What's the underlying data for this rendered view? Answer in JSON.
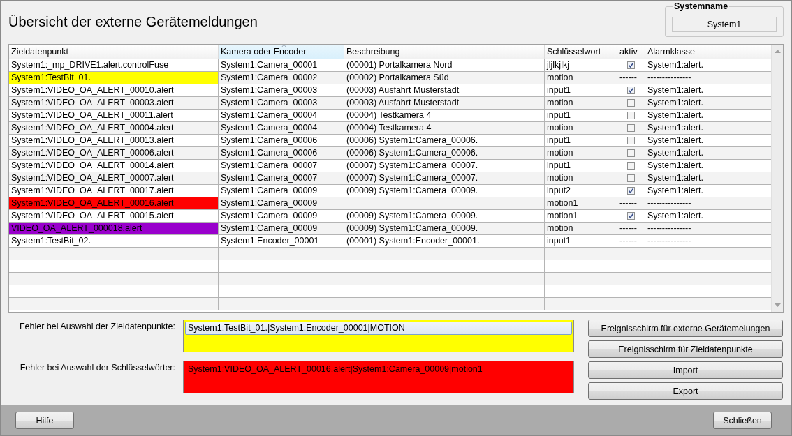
{
  "window": {
    "title": "Übersicht der externe Gerätemeldungen"
  },
  "system_name": {
    "label": "Systemname",
    "value": "System1"
  },
  "table": {
    "columns": [
      {
        "label": "Zieldatenpunkt",
        "sorted": false
      },
      {
        "label": "Kamera oder Encoder",
        "sorted": true
      },
      {
        "label": "Beschreibung",
        "sorted": false
      },
      {
        "label": "Schlüsselwort",
        "sorted": false
      },
      {
        "label": "aktiv",
        "sorted": false
      },
      {
        "label": "Alarmklasse",
        "sorted": false
      }
    ],
    "rows": [
      {
        "target": "System1:_mp_DRIVE1.alert.controlFuse",
        "source": "System1:Camera_00001",
        "description": "(00001) Portalkamera Nord",
        "keyword": "jljlkjlkj",
        "active": {
          "kind": "checkbox",
          "checked": true
        },
        "alarm_class": "System1:alert."
      },
      {
        "target": "System1:TestBit_01.",
        "color": "#ffff00",
        "source": "System1:Camera_00002",
        "description": "(00002) Portalkamera Süd",
        "keyword": "motion",
        "active": {
          "kind": "text",
          "text": "------"
        },
        "alarm_class": "---------------"
      },
      {
        "target": "System1:VIDEO_OA_ALERT_00010.alert",
        "source": "System1:Camera_00003",
        "description": "(00003) Ausfahrt Musterstadt",
        "keyword": "input1",
        "active": {
          "kind": "checkbox",
          "checked": true
        },
        "alarm_class": "System1:alert."
      },
      {
        "target": "System1:VIDEO_OA_ALERT_00003.alert",
        "source": "System1:Camera_00003",
        "description": "(00003) Ausfahrt Musterstadt",
        "keyword": "motion",
        "active": {
          "kind": "checkbox",
          "checked": false
        },
        "alarm_class": "System1:alert."
      },
      {
        "target": "System1:VIDEO_OA_ALERT_00011.alert",
        "source": "System1:Camera_00004",
        "description": "(00004) Testkamera 4",
        "keyword": "input1",
        "active": {
          "kind": "checkbox",
          "checked": false
        },
        "alarm_class": "System1:alert."
      },
      {
        "target": "System1:VIDEO_OA_ALERT_00004.alert",
        "source": "System1:Camera_00004",
        "description": "(00004) Testkamera 4",
        "keyword": "motion",
        "active": {
          "kind": "checkbox",
          "checked": false
        },
        "alarm_class": "System1:alert."
      },
      {
        "target": "System1:VIDEO_OA_ALERT_00013.alert",
        "source": "System1:Camera_00006",
        "description": "(00006) System1:Camera_00006.",
        "keyword": "input1",
        "active": {
          "kind": "checkbox",
          "checked": false
        },
        "alarm_class": "System1:alert."
      },
      {
        "target": "System1:VIDEO_OA_ALERT_00006.alert",
        "source": "System1:Camera_00006",
        "description": "(00006) System1:Camera_00006.",
        "keyword": "motion",
        "active": {
          "kind": "checkbox",
          "checked": false
        },
        "alarm_class": "System1:alert."
      },
      {
        "target": "System1:VIDEO_OA_ALERT_00014.alert",
        "source": "System1:Camera_00007",
        "description": "(00007) System1:Camera_00007.",
        "keyword": "input1",
        "active": {
          "kind": "checkbox",
          "checked": false
        },
        "alarm_class": "System1:alert."
      },
      {
        "target": "System1:VIDEO_OA_ALERT_00007.alert",
        "source": "System1:Camera_00007",
        "description": "(00007) System1:Camera_00007.",
        "keyword": "motion",
        "active": {
          "kind": "checkbox",
          "checked": false
        },
        "alarm_class": "System1:alert."
      },
      {
        "target": "System1:VIDEO_OA_ALERT_00017.alert",
        "source": "System1:Camera_00009",
        "description": "(00009) System1:Camera_00009.",
        "keyword": "input2",
        "active": {
          "kind": "checkbox",
          "checked": true
        },
        "alarm_class": "System1:alert."
      },
      {
        "target": "System1:VIDEO_OA_ALERT_00016.alert",
        "color": "#ff0000",
        "source": "System1:Camera_00009",
        "keyword": "motion1",
        "active": {
          "kind": "text",
          "text": "------"
        },
        "alarm_class": "---------------"
      },
      {
        "target": "System1:VIDEO_OA_ALERT_00015.alert",
        "source": "System1:Camera_00009",
        "description": "(00009) System1:Camera_00009.",
        "keyword": "motion1",
        "active": {
          "kind": "checkbox",
          "checked": true
        },
        "alarm_class": "System1:alert."
      },
      {
        "target": "VIDEO_OA_ALERT_000018.alert",
        "color": "#9900cc",
        "source": "System1:Camera_00009",
        "description": "(00009) System1:Camera_00009.",
        "keyword": "motion",
        "active": {
          "kind": "text",
          "text": "------"
        },
        "alarm_class": "---------------"
      },
      {
        "target": "System1:TestBit_02.",
        "source": "System1:Encoder_00001",
        "description": "(00001) System1:Encoder_00001.",
        "keyword": "input1",
        "active": {
          "kind": "text",
          "text": "------"
        },
        "alarm_class": "---------------"
      }
    ]
  },
  "errors": [
    {
      "label": "Fehler bei Auswahl der Zieldatenpunkte:",
      "color": "#ffff00",
      "items": [
        {
          "text": "System1:TestBit_01.|System1:Encoder_00001|MOTION",
          "selected": true
        }
      ]
    },
    {
      "label": "Fehler bei Auswahl der Schlüsselwörter:",
      "color": "#ff0000",
      "items": [
        {
          "text": "System1:VIDEO_OA_ALERT_00016.alert|System1:Camera_00009|motion1",
          "selected": false
        }
      ]
    }
  ],
  "actions": [
    "Ereignisschirm für externe Gerätemelungen",
    "Ereignisschirm für Zieldatenpunkte",
    "Import",
    "Export"
  ],
  "footer": {
    "help": "Hilfe",
    "close": "Schließen"
  }
}
